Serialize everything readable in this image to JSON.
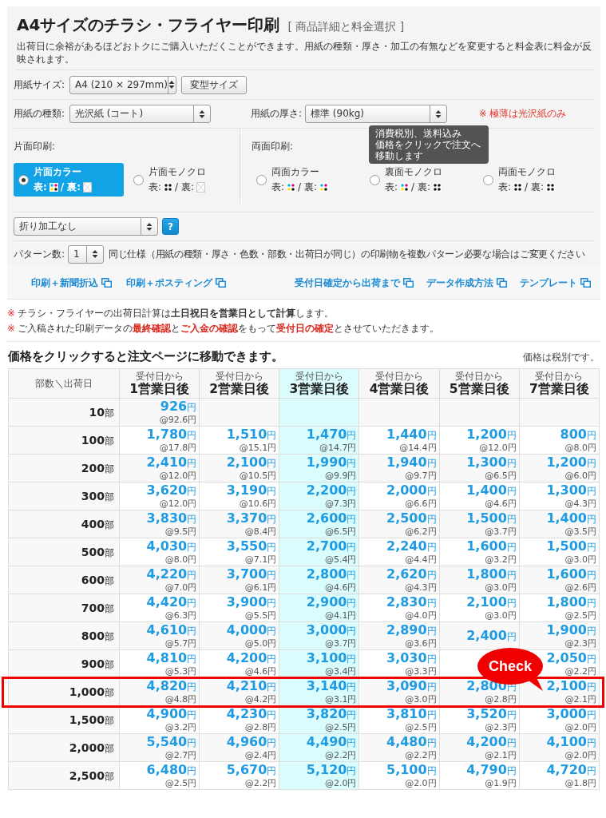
{
  "header": {
    "title": "A4サイズのチラシ・フライヤー印刷",
    "subtitle": "[ 商品詳細と料金選択 ]",
    "description": "出荷日に余裕があるほどおトクにご購入いただくことができます。用紙の種類・厚さ・加工の有無などを変更すると料金表に料金が反映されます。"
  },
  "paper_size": {
    "label": "用紙サイズ:",
    "value": "A4 (210 × 297mm)",
    "button": "変型サイズ"
  },
  "paper_type": {
    "label": "用紙の種類:",
    "value": "光沢紙 (コート)"
  },
  "paper_weight": {
    "label": "用紙の厚さ:",
    "value": "標準 (90kg)",
    "note": "※ 極薄は光沢紙のみ"
  },
  "print_groups": [
    {
      "label": "片面印刷:",
      "options": [
        {
          "label": "片面カラー",
          "selected": true,
          "sides": [
            {
              "label": "表:",
              "kind": "color"
            },
            {
              "label": "/ 裏:",
              "kind": "none"
            }
          ]
        },
        {
          "label": "片面モノクロ",
          "selected": false,
          "sides": [
            {
              "label": "表:",
              "kind": "mono"
            },
            {
              "label": "/ 裏:",
              "kind": "none"
            }
          ]
        }
      ]
    },
    {
      "label": "両面印刷:",
      "options": [
        {
          "label": "両面カラー",
          "selected": false,
          "sides": [
            {
              "label": "表:",
              "kind": "color"
            },
            {
              "label": "/ 裏:",
              "kind": "color"
            }
          ]
        },
        {
          "label": "裏面モノクロ",
          "selected": false,
          "sides": [
            {
              "label": "表:",
              "kind": "color"
            },
            {
              "label": "/ 裏:",
              "kind": "mono"
            }
          ]
        },
        {
          "label": "両面モノクロ",
          "selected": false,
          "sides": [
            {
              "label": "表:",
              "kind": "mono"
            },
            {
              "label": "/ 裏:",
              "kind": "mono"
            }
          ]
        }
      ]
    }
  ],
  "tooltip": {
    "lines": [
      "消費税別、送料込み",
      "価格をクリックで注文へ",
      "移動します"
    ]
  },
  "folding": {
    "value": "折り加工なし",
    "help": "?"
  },
  "patterns": {
    "label": "パターン数:",
    "value": "1",
    "note": "同じ仕様（用紙の種類・厚さ・色数・部数・出荷日が同じ）の印刷物を複数パターン必要な場合はご変更ください"
  },
  "links_left": [
    "印刷＋新聞折込",
    "印刷＋ポスティング"
  ],
  "links_right": [
    "受付日確定から出荷まで",
    "データ作成方法",
    "テンプレート"
  ],
  "notes": [
    {
      "mark": "※",
      "kind": "plain",
      "text": "チラシ・フライヤーの出荷日計算は**土日祝日を営業日として計算**します。"
    },
    {
      "mark": "※",
      "kind": "alert",
      "text": "ご入稿された印刷データの**最終確認**と**ご入金の確認**をもって**受付日の確定**とさせていただきます。"
    }
  ],
  "table_heading": {
    "title": "価格をクリックすると注文ページに移動できます。",
    "note": "価格は税別です。"
  },
  "table": {
    "corner": "部数＼出荷日",
    "columns": [
      {
        "top": "受付日から",
        "main": "1営業日後",
        "selected": false
      },
      {
        "top": "受付日から",
        "main": "2営業日後",
        "selected": false
      },
      {
        "top": "受付日から",
        "main": "3営業日後",
        "selected": true
      },
      {
        "top": "受付日から",
        "main": "4営業日後",
        "selected": false
      },
      {
        "top": "受付日から",
        "main": "5営業日後",
        "selected": false
      },
      {
        "top": "受付日から",
        "main": "7営業日後",
        "selected": false
      }
    ],
    "callout": {
      "text": "Check"
    },
    "rows": [
      {
        "qty": "10部",
        "highlighted": false,
        "cells": [
          [
            "926円",
            "@92.6円"
          ],
          null,
          null,
          null,
          null,
          null
        ]
      },
      {
        "qty": "100部",
        "highlighted": false,
        "cells": [
          [
            "1,780円",
            "@17.8円"
          ],
          [
            "1,510円",
            "@15.1円"
          ],
          [
            "1,470円",
            "@14.7円"
          ],
          [
            "1,440円",
            "@14.4円"
          ],
          [
            "1,200円",
            "@12.0円"
          ],
          [
            "800円",
            "@8.0円"
          ]
        ]
      },
      {
        "qty": "200部",
        "highlighted": false,
        "cells": [
          [
            "2,410円",
            "@12.0円"
          ],
          [
            "2,100円",
            "@10.5円"
          ],
          [
            "1,990円",
            "@9.9円"
          ],
          [
            "1,940円",
            "@9.7円"
          ],
          [
            "1,300円",
            "@6.5円"
          ],
          [
            "1,200円",
            "@6.0円"
          ]
        ]
      },
      {
        "qty": "300部",
        "highlighted": false,
        "cells": [
          [
            "3,620円",
            "@12.0円"
          ],
          [
            "3,190円",
            "@10.6円"
          ],
          [
            "2,200円",
            "@7.3円"
          ],
          [
            "2,000円",
            "@6.6円"
          ],
          [
            "1,400円",
            "@4.6円"
          ],
          [
            "1,300円",
            "@4.3円"
          ]
        ]
      },
      {
        "qty": "400部",
        "highlighted": false,
        "cells": [
          [
            "3,830円",
            "@9.5円"
          ],
          [
            "3,370円",
            "@8.4円"
          ],
          [
            "2,600円",
            "@6.5円"
          ],
          [
            "2,500円",
            "@6.2円"
          ],
          [
            "1,500円",
            "@3.7円"
          ],
          [
            "1,400円",
            "@3.5円"
          ]
        ]
      },
      {
        "qty": "500部",
        "highlighted": false,
        "cells": [
          [
            "4,030円",
            "@8.0円"
          ],
          [
            "3,550円",
            "@7.1円"
          ],
          [
            "2,700円",
            "@5.4円"
          ],
          [
            "2,240円",
            "@4.4円"
          ],
          [
            "1,600円",
            "@3.2円"
          ],
          [
            "1,500円",
            "@3.0円"
          ]
        ]
      },
      {
        "qty": "600部",
        "highlighted": false,
        "cells": [
          [
            "4,220円",
            "@7.0円"
          ],
          [
            "3,700円",
            "@6.1円"
          ],
          [
            "2,800円",
            "@4.6円"
          ],
          [
            "2,620円",
            "@4.3円"
          ],
          [
            "1,800円",
            "@3.0円"
          ],
          [
            "1,600円",
            "@2.6円"
          ]
        ]
      },
      {
        "qty": "700部",
        "highlighted": false,
        "cells": [
          [
            "4,420円",
            "@6.3円"
          ],
          [
            "3,900円",
            "@5.5円"
          ],
          [
            "2,900円",
            "@4.1円"
          ],
          [
            "2,830円",
            "@4.0円"
          ],
          [
            "2,100円",
            "@3.0円"
          ],
          [
            "1,800円",
            "@2.5円"
          ]
        ]
      },
      {
        "qty": "800部",
        "highlighted": false,
        "cells": [
          [
            "4,610円",
            "@5.7円"
          ],
          [
            "4,000円",
            "@5.0円"
          ],
          [
            "3,000円",
            "@3.7円"
          ],
          [
            "2,890円",
            "@3.6円"
          ],
          [
            "2,400円"
          ],
          [
            "1,900円",
            "@2.3円"
          ]
        ]
      },
      {
        "qty": "900部",
        "highlighted": false,
        "cells": [
          [
            "4,810円",
            "@5.3円"
          ],
          [
            "4,200円",
            "@4.6円"
          ],
          [
            "3,100円",
            "@3.4円"
          ],
          [
            "3,030円",
            "@3.3円"
          ],
          null,
          [
            "2,050円",
            "@2.2円"
          ]
        ]
      },
      {
        "qty": "1,000部",
        "highlighted": true,
        "cells": [
          [
            "4,820円",
            "@4.8円"
          ],
          [
            "4,210円",
            "@4.2円"
          ],
          [
            "3,140円",
            "@3.1円"
          ],
          [
            "3,090円",
            "@3.0円"
          ],
          [
            "2,800円",
            "@2.8円"
          ],
          [
            "2,100円",
            "@2.1円"
          ]
        ]
      },
      {
        "qty": "1,500部",
        "highlighted": false,
        "cells": [
          [
            "4,900円",
            "@3.2円"
          ],
          [
            "4,230円",
            "@2.8円"
          ],
          [
            "3,820円",
            "@2.5円"
          ],
          [
            "3,810円",
            "@2.5円"
          ],
          [
            "3,520円",
            "@2.3円"
          ],
          [
            "3,000円",
            "@2.0円"
          ]
        ]
      },
      {
        "qty": "2,000部",
        "highlighted": false,
        "cells": [
          [
            "5,540円",
            "@2.7円"
          ],
          [
            "4,960円",
            "@2.4円"
          ],
          [
            "4,490円",
            "@2.2円"
          ],
          [
            "4,480円",
            "@2.2円"
          ],
          [
            "4,200円",
            "@2.1円"
          ],
          [
            "4,100円",
            "@2.0円"
          ]
        ]
      },
      {
        "qty": "2,500部",
        "highlighted": false,
        "cells": [
          [
            "6,480円",
            "@2.5円"
          ],
          [
            "5,670円",
            "@2.2円"
          ],
          [
            "5,120円",
            "@2.0円"
          ],
          [
            "5,100円",
            "@2.0円"
          ],
          [
            "4,790円",
            "@1.9円"
          ],
          [
            "4,720円",
            "@1.8円"
          ]
        ]
      }
    ]
  }
}
